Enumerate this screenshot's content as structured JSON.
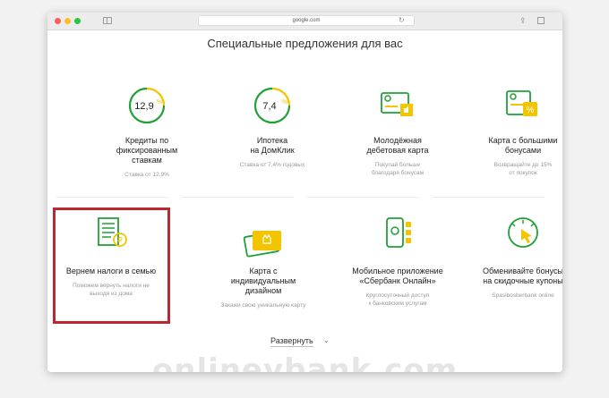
{
  "browser": {
    "url": "google.com"
  },
  "page": {
    "title": "Специальные предложения для вас",
    "expand_label": "Развернуть",
    "watermark": "onlinevbank.com"
  },
  "icons": {
    "card1_value": "12,9",
    "card1_symbol": "%",
    "card2_value": "7,4",
    "card2_symbol": "%",
    "percent_symbol": "%",
    "ruble_symbol": "₽"
  },
  "cards": [
    {
      "title_lines": [
        "Кредиты по",
        "фиксированным",
        "ставкам"
      ],
      "sub_lines": [
        "Ставка от 12,9%"
      ]
    },
    {
      "title_lines": [
        "Ипотека",
        "на ДомКлик"
      ],
      "sub_lines": [
        "Ставка от 7,4% годовых"
      ]
    },
    {
      "title_lines": [
        "Молодёжная",
        "дебетовая карта"
      ],
      "sub_lines": [
        "Покупай больше",
        "благодаря бонусам"
      ]
    },
    {
      "title_lines": [
        "Карта с большими",
        "бонусами"
      ],
      "sub_lines": [
        "Возвращайте до 15%",
        "от покупок"
      ]
    },
    {
      "title_lines": [
        "Вернем налоги в семью"
      ],
      "sub_lines": [
        "Поможем вернуть налоги не",
        "выходя из дома"
      ]
    },
    {
      "title_lines": [
        "Карта с",
        "индивидуальным",
        "дизайном"
      ],
      "sub_lines": [
        "Закажи свою уникальную карту"
      ]
    },
    {
      "title_lines": [
        "Мобильное приложение",
        "«Сбербанк Онлайн»"
      ],
      "sub_lines": [
        "Круглосуточный доступ",
        "к банковским услугам"
      ]
    },
    {
      "title_lines": [
        "Обменивайте бонусы",
        "на скидочные купоны"
      ],
      "sub_lines": [
        "Spasibosberbank online"
      ]
    }
  ],
  "colors": {
    "accent_green": "#21a038",
    "accent_yellow": "#f2c500",
    "highlight_red": "#c0262d"
  }
}
